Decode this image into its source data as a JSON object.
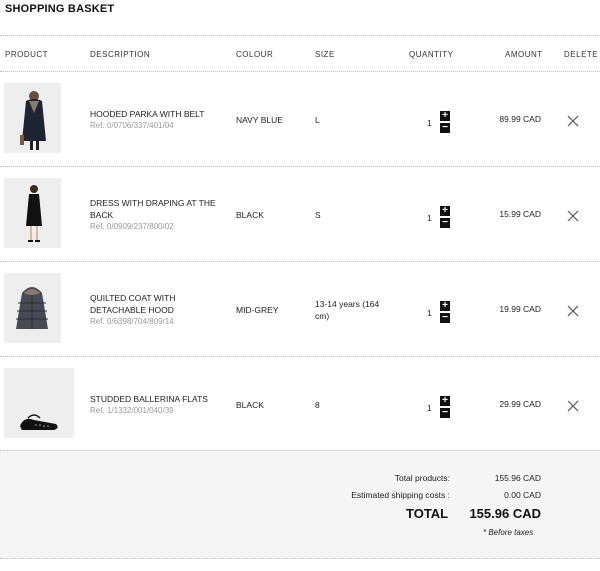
{
  "title": "SHOPPING BASKET",
  "columns": {
    "product": "PRODUCT",
    "description": "DESCRIPTION",
    "colour": "COLOUR",
    "size": "SIZE",
    "quantity": "QUANTITY",
    "amount": "AMOUNT",
    "delete": "DELETE"
  },
  "items": [
    {
      "name": "HOODED PARKA WITH BELT",
      "ref": "Ref. 0/0706/337/401/04",
      "colour": "NAVY BLUE",
      "size": "L",
      "quantity": "1",
      "amount": "89.99 CAD"
    },
    {
      "name": "DRESS WITH DRAPING AT THE BACK",
      "ref": "Ref. 0/0909/237/800/02",
      "colour": "BLACK",
      "size": "S",
      "quantity": "1",
      "amount": "15.99 CAD"
    },
    {
      "name": "QUILTED COAT WITH DETACHABLE HOOD",
      "ref": "Ref. 0/6398/704/809/14",
      "colour": "MID-GREY",
      "size": "13-14 years (164 cm)",
      "quantity": "1",
      "amount": "19.99 CAD"
    },
    {
      "name": "STUDDED BALLERINA FLATS",
      "ref": "Ref. 1/1332/001/040/39",
      "colour": "BLACK",
      "size": "8",
      "quantity": "1",
      "amount": "29.99 CAD"
    }
  ],
  "stepper": {
    "plus": "+",
    "minus": "−"
  },
  "summary": {
    "total_products_label": "Total products:",
    "total_products_value": "155.96 CAD",
    "shipping_label": "Estimated shipping costs :",
    "shipping_value": "0.00 CAD",
    "total_label": "TOTAL",
    "total_value": "155.96 CAD",
    "note": "* Before taxes"
  },
  "icons": {
    "delete": "close-icon",
    "plus": "plus-icon",
    "minus": "minus-icon"
  }
}
